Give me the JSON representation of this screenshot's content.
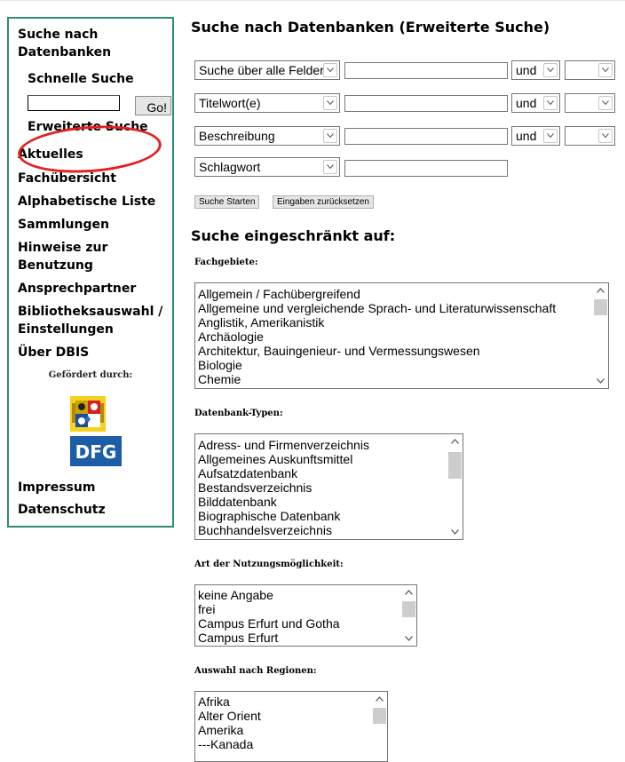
{
  "sidebar": {
    "search_db_label": "Suche nach Datenbanken",
    "quick_search_label": "Schnelle Suche",
    "quick_search_value": "",
    "go_label": "Go!",
    "advanced_search_label": "Erweiterte Suche",
    "news_label": "Aktuelles",
    "subject_overview_label": "Fachübersicht",
    "alpha_list_label": "Alphabetische Liste",
    "collections_label": "Sammlungen",
    "usage_notes_label": "Hinweise zur Benutzung",
    "contacts_label": "Ansprechpartner",
    "library_select_label": "Bibliotheksauswahl / Einstellungen",
    "about_label": "Über DBIS",
    "funded_by_label": "Gefördert durch:",
    "dfg_logo_text": "DFG",
    "imprint_label": "Impressum",
    "privacy_label": "Datenschutz",
    "annotation_color": "#e41f1f",
    "frame_color": "#2e8b77"
  },
  "main": {
    "title": "Suche nach Datenbanken (Erweiterte Suche)",
    "rows": [
      {
        "field": "Suche über alle Felder",
        "value": "",
        "operator": "und"
      },
      {
        "field": "Titelwort(e)",
        "value": "",
        "operator": "und"
      },
      {
        "field": "Beschreibung",
        "value": "",
        "operator": "und"
      },
      {
        "field": "Schlagwort",
        "value": ""
      }
    ],
    "start_button": "Suche Starten",
    "reset_button": "Eingaben zurücksetzen",
    "restricted_heading": "Suche eingeschränkt auf:",
    "subjects": {
      "label": "Fachgebiete:",
      "options": [
        "Allgemein / Fachübergreifend",
        "Allgemeine und vergleichende Sprach- und Literaturwissenschaft",
        "Anglistik, Amerikanistik",
        "Archäologie",
        "Architektur, Bauingenieur- und Vermessungswesen",
        "Biologie",
        "Chemie"
      ]
    },
    "db_types": {
      "label": "Datenbank-Typen:",
      "options": [
        "Adress- und Firmenverzeichnis",
        "Allgemeines Auskunftsmittel",
        "Aufsatzdatenbank",
        "Bestandsverzeichnis",
        "Bilddatenbank",
        "Biographische Datenbank",
        "Buchhandelsverzeichnis"
      ]
    },
    "access": {
      "label": "Art der Nutzungsmöglichkeit:",
      "options": [
        "keine Angabe",
        "frei",
        "Campus Erfurt und Gotha",
        "Campus Erfurt"
      ]
    },
    "regions": {
      "label": "Auswahl nach Regionen:",
      "options": [
        "Afrika",
        "Alter Orient",
        "Amerika",
        "---Kanada"
      ]
    }
  }
}
